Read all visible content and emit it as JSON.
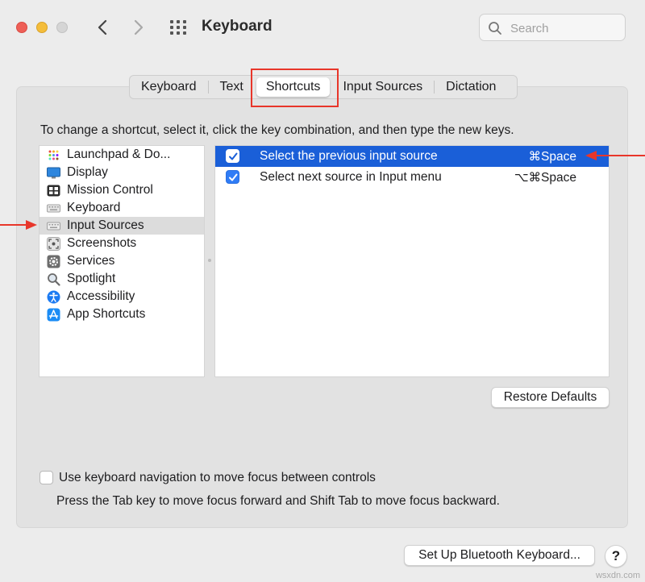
{
  "window": {
    "title": "Keyboard",
    "search_placeholder": "Search"
  },
  "tabs": [
    {
      "label": "Keyboard",
      "active": false
    },
    {
      "label": "Text",
      "active": false
    },
    {
      "label": "Shortcuts",
      "active": true
    },
    {
      "label": "Input Sources",
      "active": false
    },
    {
      "label": "Dictation",
      "active": false
    }
  ],
  "instructions": "To change a shortcut, select it, click the key combination, and then type the new keys.",
  "categories": [
    {
      "label": "Launchpad & Do...",
      "icon": "launchpad-icon",
      "selected": false
    },
    {
      "label": "Display",
      "icon": "display-icon",
      "selected": false
    },
    {
      "label": "Mission Control",
      "icon": "mission-control-icon",
      "selected": false
    },
    {
      "label": "Keyboard",
      "icon": "keyboard-icon",
      "selected": false
    },
    {
      "label": "Input Sources",
      "icon": "input-sources-icon",
      "selected": true
    },
    {
      "label": "Screenshots",
      "icon": "screenshot-icon",
      "selected": false
    },
    {
      "label": "Services",
      "icon": "gear-icon",
      "selected": false
    },
    {
      "label": "Spotlight",
      "icon": "magnifier-icon",
      "selected": false
    },
    {
      "label": "Accessibility",
      "icon": "accessibility-icon",
      "selected": false
    },
    {
      "label": "App Shortcuts",
      "icon": "app-store-icon",
      "selected": false
    }
  ],
  "shortcuts": [
    {
      "label": "Select the previous input source",
      "keys": "⌘Space",
      "checked": true,
      "selected": true
    },
    {
      "label": "Select next source in Input menu",
      "keys": "⌥⌘Space",
      "checked": true,
      "selected": false
    }
  ],
  "buttons": {
    "restore_defaults": "Restore Defaults",
    "bluetooth": "Set Up Bluetooth Keyboard...",
    "help": "?"
  },
  "keyboard_navigation": {
    "label": "Use keyboard navigation to move focus between controls",
    "description": "Press the Tab key to move focus forward and Shift Tab to move focus backward.",
    "checked": false
  },
  "colors": {
    "selection_blue": "#1a5fd8",
    "checkbox_blue": "#2f7cf6",
    "annotation_red": "#e8362a"
  },
  "watermark": "wsxdn.com"
}
